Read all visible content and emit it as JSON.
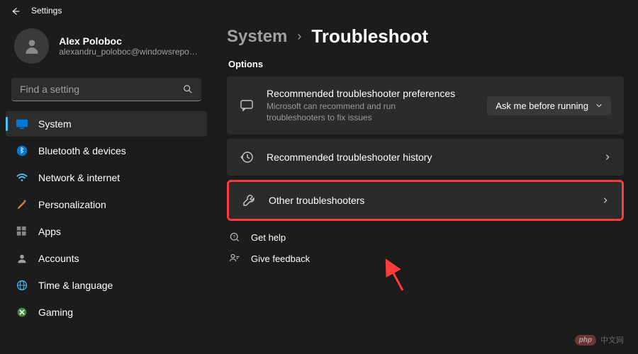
{
  "app": {
    "title": "Settings"
  },
  "profile": {
    "name": "Alex Poloboc",
    "email": "alexandru_poloboc@windowsreport..."
  },
  "search": {
    "placeholder": "Find a setting"
  },
  "nav": {
    "items": [
      {
        "label": "System",
        "active": true
      },
      {
        "label": "Bluetooth & devices"
      },
      {
        "label": "Network & internet"
      },
      {
        "label": "Personalization"
      },
      {
        "label": "Apps"
      },
      {
        "label": "Accounts"
      },
      {
        "label": "Time & language"
      },
      {
        "label": "Gaming"
      }
    ]
  },
  "breadcrumb": {
    "parent": "System",
    "current": "Troubleshoot"
  },
  "section_label": "Options",
  "cards": {
    "recommended": {
      "title": "Recommended troubleshooter preferences",
      "subtitle": "Microsoft can recommend and run troubleshooters to fix issues",
      "dropdown": "Ask me before running"
    },
    "history": {
      "title": "Recommended troubleshooter history"
    },
    "other": {
      "title": "Other troubleshooters"
    }
  },
  "help": {
    "get_help": "Get help",
    "feedback": "Give feedback"
  },
  "watermark": {
    "badge": "php",
    "text": "中文网"
  }
}
